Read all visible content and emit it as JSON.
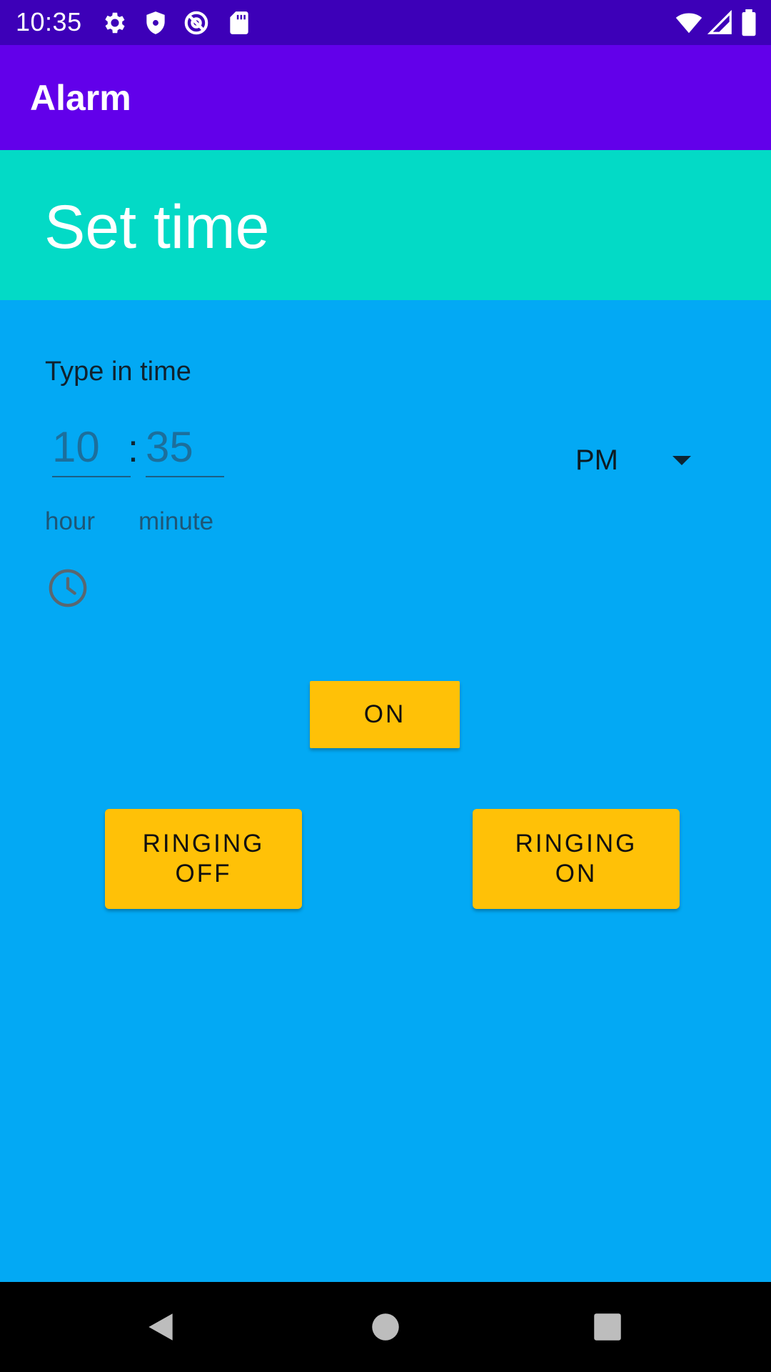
{
  "status_bar": {
    "time": "10:35",
    "icons": [
      "gear-icon",
      "shield-icon",
      "at-sign-icon",
      "sd-card-icon",
      "wifi-icon",
      "signal-icon",
      "battery-icon"
    ]
  },
  "app_bar": {
    "title": "Alarm",
    "color": "#6200ea"
  },
  "header": {
    "title": "Set time",
    "color": "#03dac6"
  },
  "time_input": {
    "label": "Type in time",
    "hour_value": "10",
    "hour_caption": "hour",
    "separator": ":",
    "minute_value": "35",
    "minute_caption": "minute",
    "ampm_value": "PM"
  },
  "buttons": {
    "on_label": "ON",
    "ringing_off_label": "RINGING\nOFF",
    "ringing_on_label": "RINGING\nON",
    "color": "#ffc107"
  },
  "theme": {
    "status_bar": "#3d00b8",
    "background": "#03a9f4"
  },
  "nav_bar": {
    "icons": [
      "back-icon",
      "home-icon",
      "recents-icon"
    ]
  }
}
